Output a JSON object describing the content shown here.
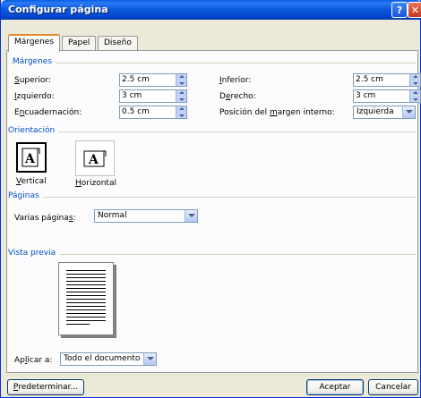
{
  "window": {
    "title": "Configurar página",
    "help_glyph": "?",
    "close_glyph": "✕"
  },
  "tabs": [
    {
      "label": "Márgenes",
      "active": true
    },
    {
      "label": "Papel",
      "active": false
    },
    {
      "label": "Diseño",
      "active": false
    }
  ],
  "margins": {
    "group_label": "Márgenes",
    "superior": {
      "label_u": "S",
      "label_rest": "uperior:",
      "value": "2.5 cm"
    },
    "inferior": {
      "label_u": "I",
      "label_rest": "nferior:",
      "value": "2.5 cm"
    },
    "izquierdo": {
      "label_u": "I",
      "label_rest": "zquierdo:",
      "value": "3 cm"
    },
    "derecho": {
      "label_pre": "D",
      "label_u": "e",
      "label_rest": "recho:",
      "value": "3 cm"
    },
    "encuadernacion": {
      "label_pre": "E",
      "label_u": "n",
      "label_rest": "cuadernación:",
      "value": "0.5 cm"
    },
    "posicion": {
      "label_pre": "Posición del ",
      "label_u": "m",
      "label_rest": "argen interno:",
      "value": "Izquierda"
    }
  },
  "orientation": {
    "group_label": "Orientación",
    "vertical": {
      "label_u": "V",
      "label_rest": "ertical",
      "glyph": "A"
    },
    "horizontal": {
      "label_u": "H",
      "label_rest": "orizontal",
      "glyph": "A"
    }
  },
  "pages": {
    "group_label": "Páginas",
    "label_pre": "Varias página",
    "label_u": "s",
    "label_rest": ":",
    "value": "Normal"
  },
  "preview": {
    "group_label": "Vista previa",
    "apply_pre": "Ap",
    "apply_u": "l",
    "apply_rest": "icar a:",
    "apply_value": "Todo el documento"
  },
  "buttons": {
    "default_u": "P",
    "default_rest": "redeterminar...",
    "ok": "Aceptar",
    "cancel": "Cancelar"
  }
}
